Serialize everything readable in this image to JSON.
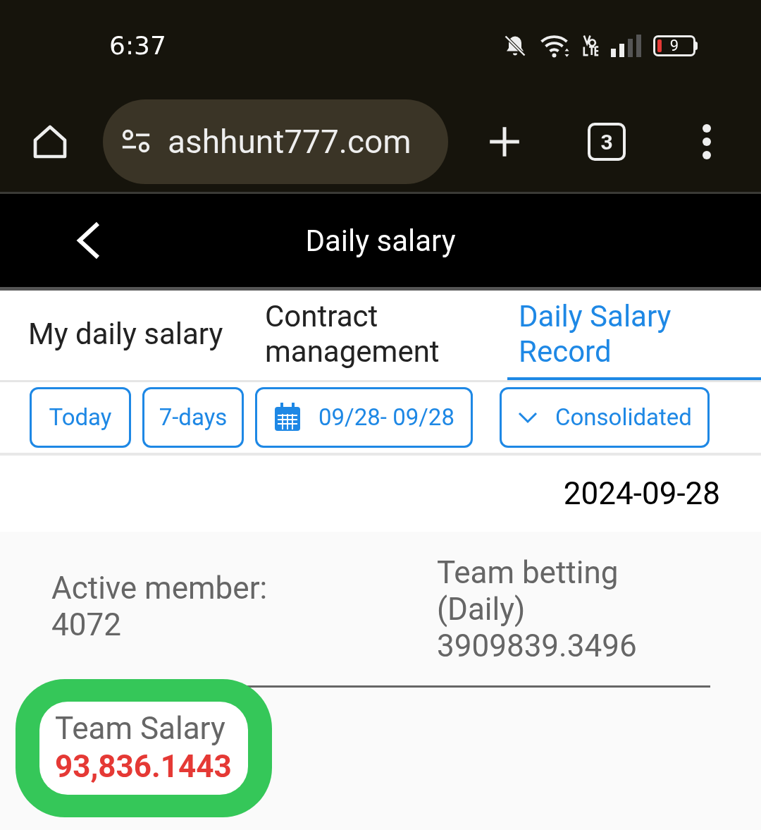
{
  "status_bar": {
    "time": "6:37",
    "battery": "9"
  },
  "browser": {
    "url": "ashhunt777.com",
    "tab_count": "3"
  },
  "header": {
    "title": "Daily salary"
  },
  "tabs": [
    {
      "label": "My daily salary",
      "selected": false
    },
    {
      "label": "Contract management",
      "selected": false
    },
    {
      "label": "Daily Salary Record",
      "selected": true
    }
  ],
  "filters": [
    {
      "kind": "plain",
      "label": "Today"
    },
    {
      "kind": "plain",
      "label": "7-days"
    },
    {
      "kind": "date",
      "label": "09/28- 09/28"
    },
    {
      "kind": "dropdown",
      "label": "Consolidated"
    }
  ],
  "record": {
    "date": "2024-09-28",
    "active_member_label": "Active member:",
    "active_member_value": "4072",
    "team_betting_label": "Team betting (Daily)",
    "team_betting_value": "3909839.3496",
    "team_salary_label": "Team Salary",
    "team_salary_value": "93,836.1443"
  }
}
